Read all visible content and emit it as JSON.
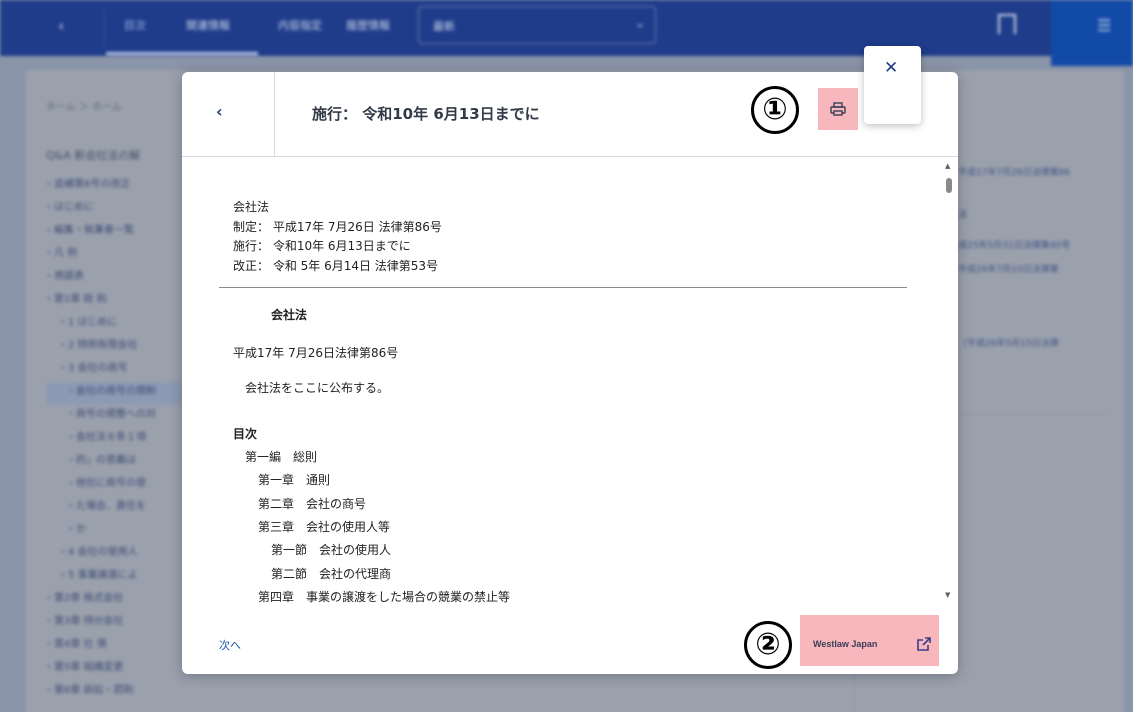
{
  "background": {
    "topbar": {
      "back_glyph": "‹",
      "tabs": [
        "目次",
        "関連情報",
        "内容指定",
        "履歴情報"
      ],
      "select_value": "最新",
      "menu_glyph": "☰"
    },
    "breadcrumb": "ホーム ＞ ホーム",
    "qa_title": "Q&A 新会社法の解",
    "tree": [
      {
        "label": "追補第6号の改正",
        "hl": false
      },
      {
        "label": "はじめに",
        "hl": false
      },
      {
        "label": "編集・執筆者一覧",
        "hl": false
      },
      {
        "label": "凡 例",
        "hl": false
      },
      {
        "label": "用語表",
        "hl": false
      },
      {
        "label": "第1章 総 則",
        "hl": false
      },
      {
        "label": "1 はじめに",
        "hl": false
      },
      {
        "label": "2 特例有限会社",
        "hl": false
      },
      {
        "label": "3 会社の商号",
        "hl": false
      },
      {
        "label": "会社の商号の規制",
        "hl": true
      },
      {
        "label": "商号の規整への対",
        "hl": false
      },
      {
        "label": "会社法８条１項",
        "hl": false
      },
      {
        "label": "的」の意義は",
        "hl": false
      },
      {
        "label": "他社に商号の使",
        "hl": false
      },
      {
        "label": "た場合、責任を",
        "hl": false
      },
      {
        "label": "か",
        "hl": false
      },
      {
        "label": "4 会社の使用人",
        "hl": false
      },
      {
        "label": "5 事業譲渡によ",
        "hl": false
      },
      {
        "label": "第2章 株式会社",
        "hl": false
      },
      {
        "label": "第3章 持分会社",
        "hl": false
      },
      {
        "label": "第4章 社 債",
        "hl": false
      },
      {
        "label": "第5章 組織変更",
        "hl": false
      },
      {
        "label": "第6章 訴訟・罰則",
        "hl": false
      }
    ],
    "right_lines": [
      "平成17年7月26日法律第86",
      "法",
      "成25年5月31日法律第40号",
      "平成26年7月10日法律第",
      "（平成26年5月15日法律"
    ]
  },
  "modal": {
    "back_glyph": "‹",
    "title": "施行： 令和10年 6月13日までに",
    "annotation_1": "①",
    "annotation_2": "②",
    "meta": [
      "会社法",
      "制定： 平成17年 7月26日 法律第86号",
      "施行： 令和10年 6月13日までに",
      "改正： 令和 5年 6月14日 法律第53号"
    ],
    "law_title": "会社法",
    "promulgation_date": "平成17年 7月26日法律第86号",
    "promulgation_text": "会社法をここに公布する。",
    "toc_heading": "目次",
    "toc": [
      {
        "text": "第一編　総則",
        "level": 1
      },
      {
        "text": "第一章　通則",
        "level": 2
      },
      {
        "text": "第二章　会社の商号",
        "level": 2
      },
      {
        "text": "第三章　会社の使用人等",
        "level": 2
      },
      {
        "text": "第一節　会社の使用人",
        "level": 3
      },
      {
        "text": "第二節　会社の代理商",
        "level": 3
      },
      {
        "text": "第四章　事業の譲渡をした場合の競業の禁止等",
        "level": 2
      }
    ],
    "next_label": "次へ",
    "westlaw_label": "Westlaw Japan",
    "scroll_up": "▲",
    "scroll_down": "▼"
  },
  "close_glyph": "✕",
  "colors": {
    "topbar": "#1f3c8a",
    "accent": "#1e3b86",
    "highlight": "#f7b7bd"
  }
}
